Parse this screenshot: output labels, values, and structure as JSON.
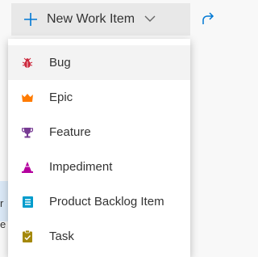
{
  "toolbar": {
    "new_item_label": "New Work Item"
  },
  "background": {
    "row_fragment_1": "r",
    "row_fragment_2": "e"
  },
  "menu": {
    "items": [
      {
        "label": "Bug",
        "icon": "bug-icon",
        "color": "#cc293d"
      },
      {
        "label": "Epic",
        "icon": "crown-icon",
        "color": "#ff7b00"
      },
      {
        "label": "Feature",
        "icon": "trophy-icon",
        "color": "#773b93"
      },
      {
        "label": "Impediment",
        "icon": "impediment-icon",
        "color": "#b4009e"
      },
      {
        "label": "Product Backlog Item",
        "icon": "backlog-item-icon",
        "color": "#009ccc"
      },
      {
        "label": "Task",
        "icon": "clipboard-icon",
        "color": "#a4880a"
      }
    ]
  },
  "colors": {
    "accent": "#0078d4"
  }
}
